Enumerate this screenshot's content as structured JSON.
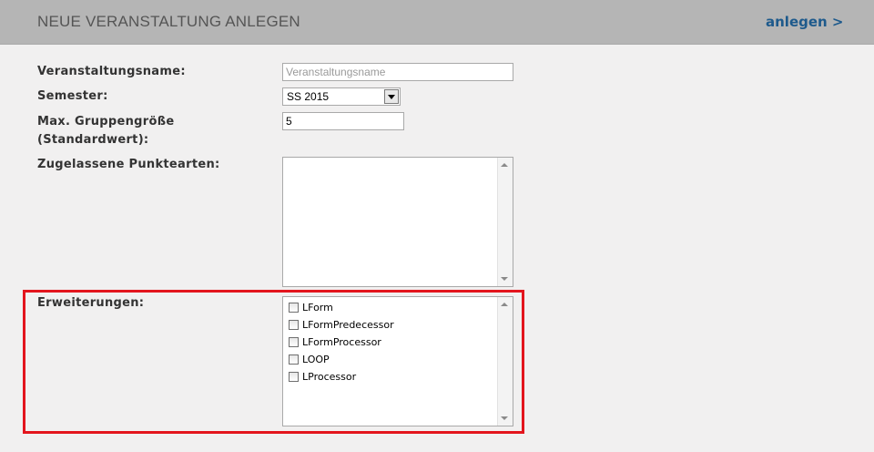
{
  "header": {
    "title": "NEUE VERANSTALTUNG ANLEGEN",
    "action_label": "anlegen >"
  },
  "form": {
    "name": {
      "label": "Veranstaltungsname:",
      "value": "",
      "placeholder": "Veranstaltungsname"
    },
    "semester": {
      "label": "Semester:",
      "selected": "SS 2015"
    },
    "group_size": {
      "label_line1": "Max. Gruppengröße",
      "label_line2": "(Standardwert):",
      "value": "5"
    },
    "point_types": {
      "label": "Zugelassene Punktearten:",
      "items": []
    },
    "extensions": {
      "label": "Erweiterungen:",
      "items": [
        {
          "label": "LForm",
          "checked": false
        },
        {
          "label": "LFormPredecessor",
          "checked": false
        },
        {
          "label": "LFormProcessor",
          "checked": false
        },
        {
          "label": "LOOP",
          "checked": false
        },
        {
          "label": "LProcessor",
          "checked": false
        }
      ]
    }
  },
  "colors": {
    "header_bg": "#b5b5b5",
    "panel_bg": "#f1f0f0",
    "link": "#1e5a8c",
    "highlight_border": "#e3151d"
  }
}
